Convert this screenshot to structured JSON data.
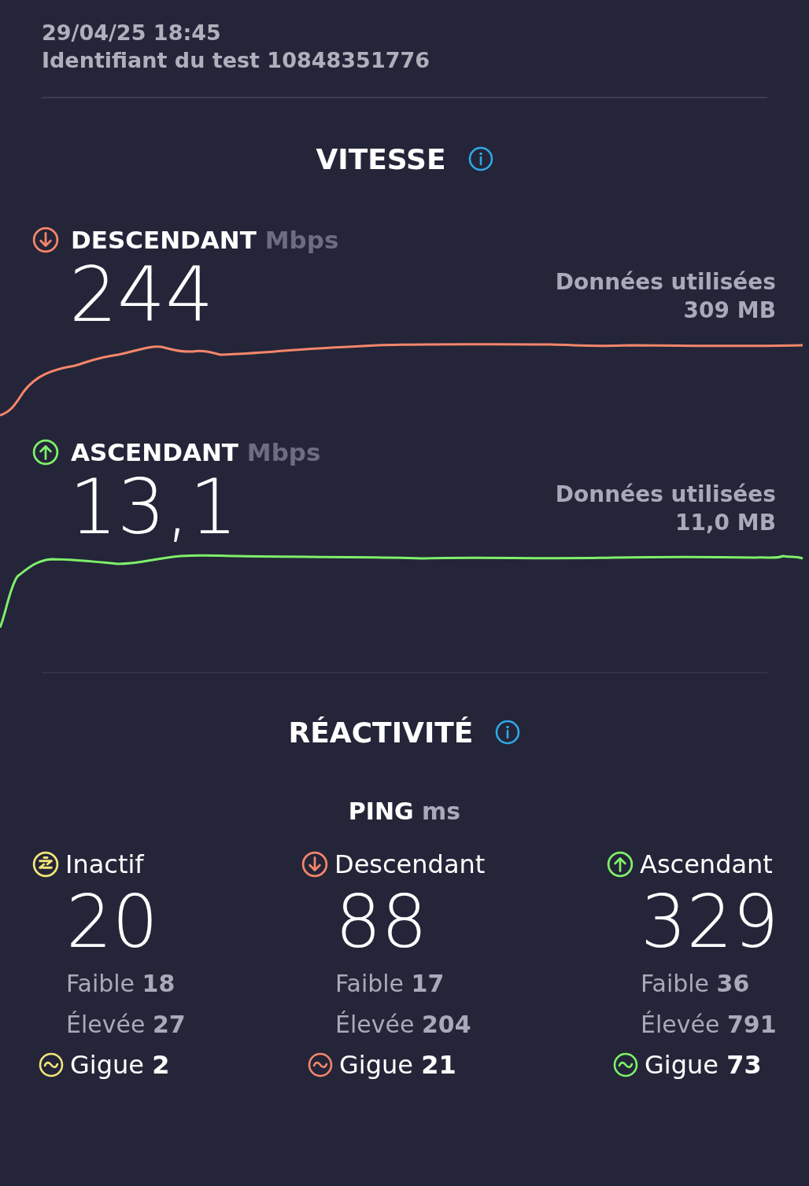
{
  "header": {
    "datetime": "29/04/25 18:45",
    "test_id": "Identifiant du test 10848351776"
  },
  "speed": {
    "title": "VITESSE",
    "metrics": [
      {
        "kind": "download",
        "label": "DESCENDANT",
        "unit": "Mbps",
        "value": "244",
        "data_label": "Données utilisées",
        "data_value": "309 MB",
        "color": "#f5866b"
      },
      {
        "kind": "upload",
        "label": "ASCENDANT",
        "unit": "Mbps",
        "value": "13,1",
        "data_label": "Données utilisées",
        "data_value": "11,0 MB",
        "color": "#7ff06a"
      }
    ]
  },
  "responsiveness": {
    "title": "RÉACTIVITÉ",
    "ping_label": "PING",
    "ping_unit": "ms",
    "columns": [
      {
        "kind": "idle",
        "label": "Inactif",
        "value": "20",
        "low_label": "Faible",
        "low": "18",
        "high_label": "Élevée",
        "high": "27",
        "jitter_label": "Gigue",
        "jitter": "2",
        "color": "#f3e57a"
      },
      {
        "kind": "download",
        "label": "Descendant",
        "value": "88",
        "low_label": "Faible",
        "low": "17",
        "high_label": "Élevée",
        "high": "204",
        "jitter_label": "Gigue",
        "jitter": "21",
        "color": "#f5866b"
      },
      {
        "kind": "upload",
        "label": "Ascendant",
        "value": "329",
        "low_label": "Faible",
        "low": "36",
        "high_label": "Élevée",
        "high": "791",
        "jitter_label": "Gigue",
        "jitter": "73",
        "color": "#7ff06a"
      }
    ]
  }
}
